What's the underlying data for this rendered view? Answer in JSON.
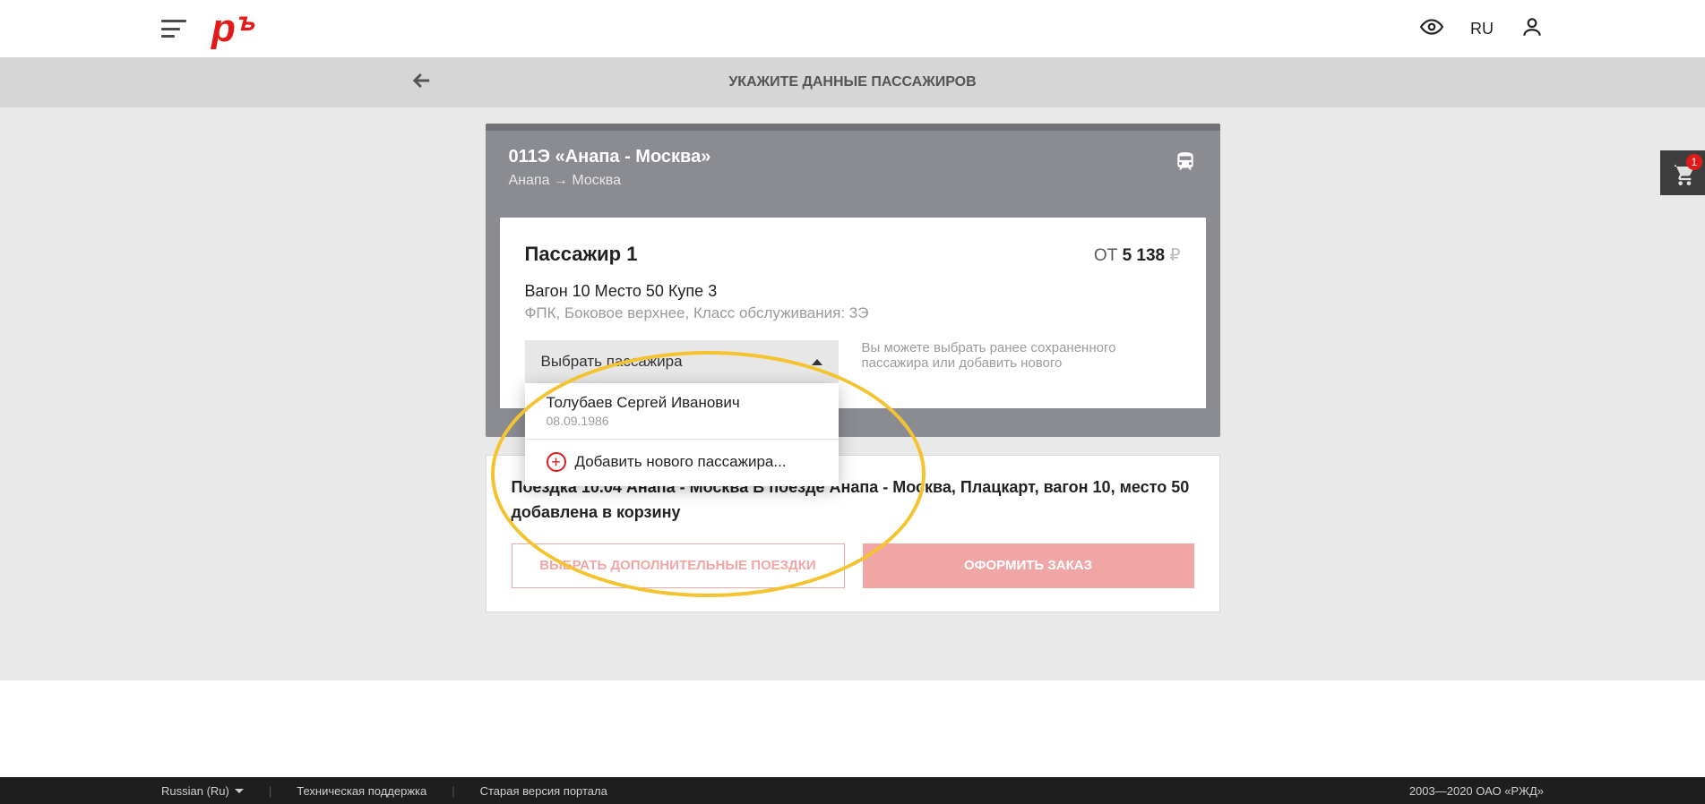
{
  "header": {
    "logo_text": "pꚜ",
    "language_short": "RU"
  },
  "subheader": {
    "title": "УКАЖИТЕ ДАННЫЕ ПАССАЖИРОВ"
  },
  "train": {
    "title": "011Э «Анапа - Москва»",
    "route": "Анапа → Москва"
  },
  "passenger": {
    "heading": "Пассажир 1",
    "price_prefix": "ОТ ",
    "price_value": "5 138",
    "price_currency": " ₽",
    "seat_line": "Вагон 10 Место 50 Купе 3",
    "class_line": "ФПК, Боковое верхнее,  Класс обслуживания: 3Э",
    "select_label": "Выбрать пассажира",
    "select_hint": "Вы можете выбрать ранее сохраненного пассажира или добавить нового",
    "saved": {
      "name": "Толубаев Сергей Иванович",
      "dob": "08.09.1986"
    },
    "add_label": "Добавить нового пассажира..."
  },
  "cart_notice": {
    "line1_prefix": "Поездка 10.04 Анапа - Москва  В поезде Анапа - Москва, Плацкарт, вагон 10, место 50",
    "line2": " добавлена в корзину"
  },
  "buttons": {
    "secondary": "ВЫБРАТЬ ДОПОЛНИТЕЛЬНЫЕ ПОЕЗДКИ",
    "primary": "ОФОРМИТЬ ЗАКАЗ"
  },
  "floating_cart": {
    "count": "1"
  },
  "footer": {
    "language": "Russian (Ru)",
    "support": "Техническая поддержка",
    "old_portal": "Старая версия портала",
    "copyright": "2003—2020 ОАО «РЖД»"
  }
}
